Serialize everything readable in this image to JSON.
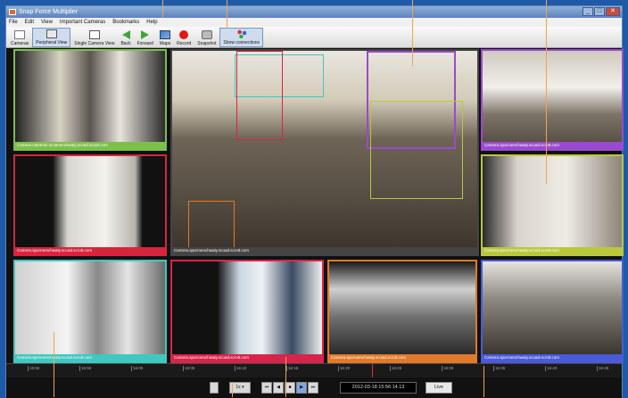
{
  "window": {
    "title": "Snap Force Multiplier"
  },
  "menu": [
    "File",
    "Edit",
    "View",
    "Important Cameras",
    "Bookmarks",
    "Help"
  ],
  "toolbar": [
    {
      "label": "Cameras",
      "icon": "camera-list-icon"
    },
    {
      "label": "Peripheral View",
      "icon": "peripheral-view-icon",
      "active": true
    },
    {
      "label": "Single Camera View",
      "icon": "single-camera-icon"
    },
    {
      "label": "Back",
      "icon": "back-arrow-icon"
    },
    {
      "label": "Forward",
      "icon": "forward-arrow-icon"
    },
    {
      "label": "Maps",
      "icon": "map-icon"
    },
    {
      "label": "Record",
      "icon": "record-icon"
    },
    {
      "label": "Snapshot",
      "icon": "snapshot-icon"
    },
    {
      "label": "Show connections",
      "icon": "connections-icon",
      "active": true
    }
  ],
  "cameras": {
    "left_top": {
      "caption": "Camera.cameras.scottoenchwaty.scoad.scrott.com",
      "color": "#7cc04a"
    },
    "left_mid": {
      "caption": "Camera.sporroenchwaty.scoad.scrott.com",
      "color": "#d8243c"
    },
    "left_bot": {
      "caption": "Camera.sporroenchwaty.scoad.scrott.com",
      "color": "#3fc8c0"
    },
    "center": {
      "caption": "Camera.sporroenchwaty.scoad.scrott.com",
      "color": "#444444"
    },
    "right_top": {
      "caption": "Camera.sporroenchwaty.scoad.scrott.com",
      "color": "#9a4ad0"
    },
    "right_mid": {
      "caption": "Camera.sporroenchwaty.scoad.scrott.com",
      "color": "#b8c83a"
    },
    "right_bot": {
      "caption": "Camera.sporroenchwaty.scoad.scrott.com",
      "color": "#4a5ad8"
    },
    "bottom_2": {
      "caption": "Camera.sporroenchwaty.scoad.scrott.com",
      "color": "#d8244a"
    },
    "bottom_3": {
      "caption": "Camera.sporroenchwaty.scoad.scrott.com",
      "color": "#e07a2a"
    }
  },
  "timeline": {
    "ticks": [
      "15:50",
      "15:55",
      "16:00",
      "16:05",
      "16:10",
      "16:15",
      "16:20",
      "16:25",
      "16:30",
      "16:35",
      "16:40",
      "16:45"
    ]
  },
  "playback": {
    "speed": "1x",
    "timestamp": "2012-03-18 15:56:14.13",
    "live_label": "Live"
  }
}
